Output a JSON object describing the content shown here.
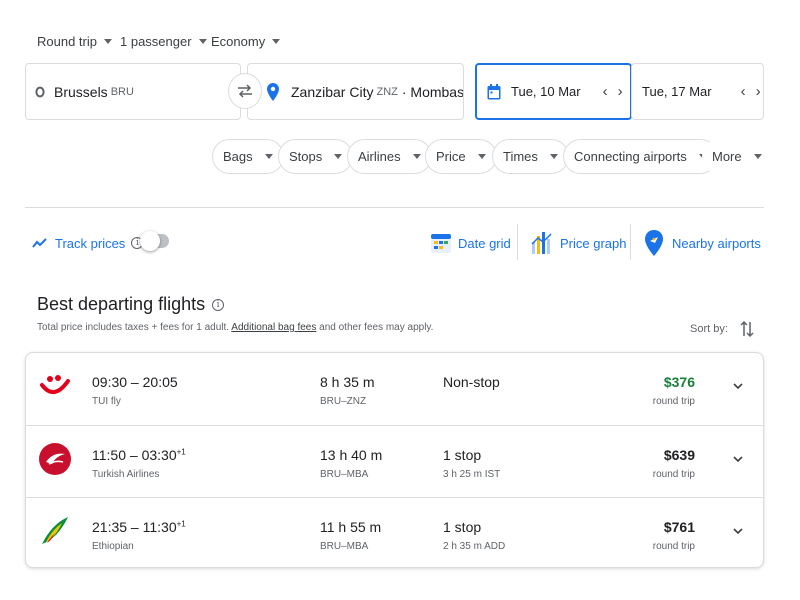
{
  "search": {
    "trip_type": "Round trip",
    "passengers": "1 passenger",
    "cabin": "Economy",
    "origin_city": "Brussels",
    "origin_code": "BRU",
    "destination_city": "Zanzibar City",
    "destination_code": "ZNZ",
    "destination_more": "· Mombasa …",
    "depart_date": "Tue, 10 Mar",
    "return_date": "Tue, 17 Mar"
  },
  "filters": [
    "Bags",
    "Stops",
    "Airlines",
    "Price",
    "Times",
    "Connecting airports",
    "More"
  ],
  "tools": {
    "track_prices": "Track prices",
    "date_grid": "Date grid",
    "price_graph": "Price graph",
    "nearby_airports": "Nearby airports"
  },
  "results": {
    "title": "Best departing flights",
    "note_prefix": "Total price includes taxes + fees for 1 adult. ",
    "note_link": "Additional bag fees",
    "note_suffix": " and other fees may apply.",
    "sort_label": "Sort by:"
  },
  "flights": [
    {
      "depart": "09:30",
      "arrive": "20:05",
      "day_offset": "",
      "airline": "TUI fly",
      "duration": "8 h 35 m",
      "route": "BRU–ZNZ",
      "stops": "Non-stop",
      "stop_detail": "",
      "price": "$376",
      "price_type": "round trip"
    },
    {
      "depart": "11:50",
      "arrive": "03:30",
      "day_offset": "+1",
      "airline": "Turkish Airlines",
      "duration": "13 h 40 m",
      "route": "BRU–MBA",
      "stops": "1 stop",
      "stop_detail": "3 h 25 m IST",
      "price": "$639",
      "price_type": "round trip"
    },
    {
      "depart": "21:35",
      "arrive": "11:30",
      "day_offset": "+1",
      "airline": "Ethiopian",
      "duration": "11 h 55 m",
      "route": "BRU–MBA",
      "stops": "1 stop",
      "stop_detail": "2 h 35 m ADD",
      "price": "$761",
      "price_type": "round trip"
    }
  ],
  "colors": {
    "accent": "#1a73e8",
    "price_low": "#188038",
    "tui_red": "#e3001b",
    "turkish_red": "#c8102e",
    "ethiopian_green": "#0a8f3c",
    "ethiopian_yellow": "#f5c400"
  }
}
